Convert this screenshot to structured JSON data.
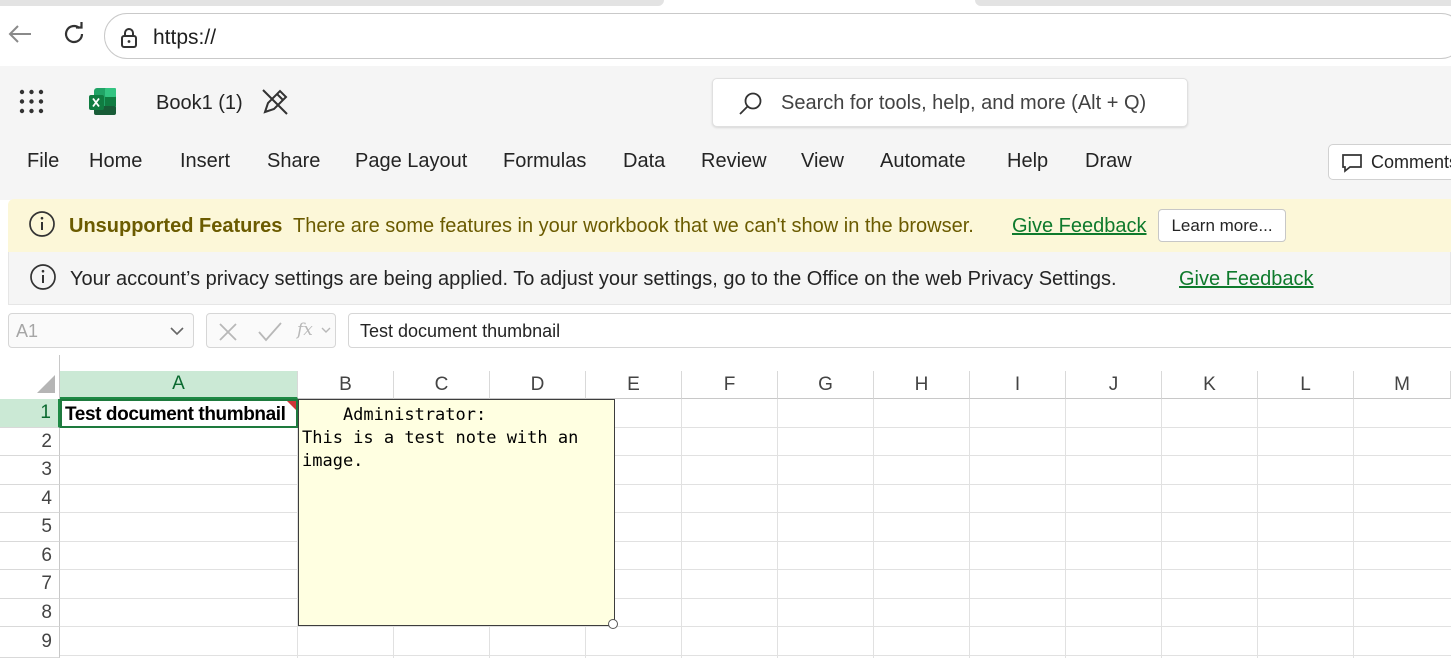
{
  "browser": {
    "url": "https://"
  },
  "app": {
    "doc_title": "Book1 (1)",
    "search_placeholder": "Search for tools, help, and more (Alt + Q)",
    "brand_color": "#107c41"
  },
  "menu": {
    "items": [
      "File",
      "Home",
      "Insert",
      "Share",
      "Page Layout",
      "Formulas",
      "Data",
      "Review",
      "View",
      "Automate",
      "Help",
      "Draw"
    ],
    "comments_label": "Comments"
  },
  "banners": {
    "unsupported": {
      "title": "Unsupported Features",
      "message": "There are some features in your workbook that we can't show in the browser.",
      "link": "Give Feedback",
      "button": "Learn more..."
    },
    "privacy": {
      "message": "Your account’s privacy settings are being applied. To adjust your settings, go to the Office on the web Privacy Settings.",
      "link": "Give Feedback"
    }
  },
  "formula_bar": {
    "name_box": "A1",
    "fx_label": "fx",
    "value": "Test document thumbnail"
  },
  "grid": {
    "columns": [
      "A",
      "B",
      "C",
      "D",
      "E",
      "F",
      "G",
      "H",
      "I",
      "J",
      "K",
      "L",
      "M"
    ],
    "rows": [
      "1",
      "2",
      "3",
      "4",
      "5",
      "6",
      "7",
      "8",
      "9"
    ],
    "selected_cell": "A1",
    "a1_value": "Test document thumbnail"
  },
  "note": {
    "text": "    Administrator:\nThis is a test note with an\nimage."
  }
}
